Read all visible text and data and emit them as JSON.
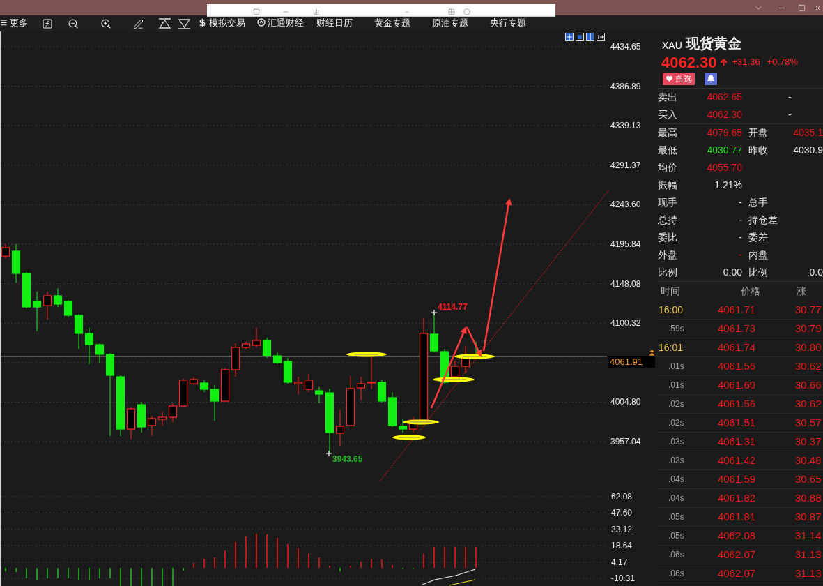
{
  "toolbar": {
    "menu_label": "更多",
    "links": [
      {
        "label": "模拟交易",
        "kind": "trade"
      },
      {
        "label": "汇通财经",
        "kind": "news"
      },
      {
        "label": "财经日历",
        "kind": "page"
      },
      {
        "label": "黄金专题",
        "kind": "page"
      },
      {
        "label": "原油专题",
        "kind": "page"
      },
      {
        "label": "央行专题",
        "kind": "page"
      }
    ]
  },
  "chart": {
    "price_axis": [
      {
        "label": "4434.65",
        "kind": "tick"
      },
      {
        "label": "4386.89",
        "kind": "tick"
      },
      {
        "label": "4339.13",
        "kind": "tick"
      },
      {
        "label": "4291.37",
        "kind": "tick"
      },
      {
        "label": "4243.60",
        "kind": "tick"
      },
      {
        "label": "4195.84",
        "kind": "tick"
      },
      {
        "label": "4148.08",
        "kind": "tick"
      },
      {
        "label": "4100.32",
        "kind": "tick"
      },
      {
        "label": "4061.91",
        "kind": "current"
      },
      {
        "label": "4004.80",
        "kind": "tick"
      },
      {
        "label": "3957.04",
        "kind": "tick"
      }
    ],
    "high_marker": "4114.77",
    "low_marker": "3943.65",
    "indicator_axis": [
      "62.08",
      "47.60",
      "33.12",
      "18.64",
      "4.17",
      "-10.31"
    ]
  },
  "quote": {
    "symbol": "XAU",
    "name": "现货黄金",
    "price": "4062.30",
    "change": "+31.36",
    "change_percent": "+0.78%",
    "watch_button": "自选",
    "bid_ask": [
      {
        "left": {
          "label": "卖出",
          "value": "4062.65",
          "color": "#e8141c"
        },
        "right": {
          "value": "-",
          "color": "#e6e6e6"
        }
      },
      {
        "left": {
          "label": "买入",
          "value": "4062.30",
          "color": "#e8141c"
        },
        "right": {
          "value": "-",
          "color": "#e6e6e6"
        }
      }
    ],
    "stats": [
      {
        "left": {
          "label": "最高",
          "value": "4079.65",
          "color": "#e8141c"
        },
        "right": {
          "label": "开盘",
          "value": "4035.1",
          "color": "#e8141c"
        }
      },
      {
        "left": {
          "label": "最低",
          "value": "4030.77",
          "color": "#17d817"
        },
        "right": {
          "label": "昨收",
          "value": "4030.9",
          "color": "#e6e6e6"
        }
      },
      {
        "left": {
          "label": "均价",
          "value": "4055.70",
          "color": "#e8141c"
        }
      },
      {
        "left": {
          "label": "振幅",
          "value": "1.21%",
          "color": "#e6e6e6"
        }
      },
      {
        "left": {
          "label": "现手",
          "value": "-",
          "color": "#e6e6e6"
        },
        "right": {
          "label": "总手"
        }
      },
      {
        "left": {
          "label": "总持",
          "value": "-",
          "color": "#e6e6e6"
        },
        "right": {
          "label": "持仓差"
        }
      },
      {
        "left": {
          "label": "委比",
          "value": "-",
          "color": "#e6e6e6"
        },
        "right": {
          "label": "委差"
        }
      },
      {
        "left": {
          "label": "外盘",
          "value": "-",
          "color": "#e8141c"
        },
        "right": {
          "label": "内盘"
        }
      },
      {
        "left": {
          "label": "比例",
          "value": "0.00",
          "color": "#e6e6e6"
        },
        "right": {
          "label": "比例",
          "value": "0.0",
          "color": "#e6e6e6"
        }
      }
    ]
  },
  "trades": {
    "columns": [
      "时间",
      "价格",
      "涨"
    ],
    "rows": [
      {
        "time": "16:00",
        "kind": "minute",
        "price": "4061.71",
        "change": "30.77"
      },
      {
        "time": ".59s",
        "kind": "tick",
        "price": "4061.73",
        "change": "30.79"
      },
      {
        "time": "16:01",
        "kind": "minute",
        "price": "4061.74",
        "change": "30.80"
      },
      {
        "time": ".01s",
        "kind": "tick",
        "price": "4061.56",
        "change": "30.62"
      },
      {
        "time": ".01s",
        "kind": "tick",
        "price": "4061.60",
        "change": "30.66"
      },
      {
        "time": ".02s",
        "kind": "tick",
        "price": "4061.56",
        "change": "30.62"
      },
      {
        "time": ".02s",
        "kind": "tick",
        "price": "4061.51",
        "change": "30.57"
      },
      {
        "time": ".03s",
        "kind": "tick",
        "price": "4061.31",
        "change": "30.37"
      },
      {
        "time": ".03s",
        "kind": "tick",
        "price": "4061.42",
        "change": "30.48"
      },
      {
        "time": ".04s",
        "kind": "tick",
        "price": "4061.59",
        "change": "30.65"
      },
      {
        "time": ".04s",
        "kind": "tick",
        "price": "4061.82",
        "change": "30.88"
      },
      {
        "time": ".05s",
        "kind": "tick",
        "price": "4061.81",
        "change": "30.87"
      },
      {
        "time": ".05s",
        "kind": "tick",
        "price": "4062.08",
        "change": "31.14"
      },
      {
        "time": ".06s",
        "kind": "tick",
        "price": "4062.07",
        "change": "31.13"
      },
      {
        "time": ".06s",
        "kind": "tick",
        "price": "4062.07",
        "change": "31.13"
      }
    ]
  }
}
